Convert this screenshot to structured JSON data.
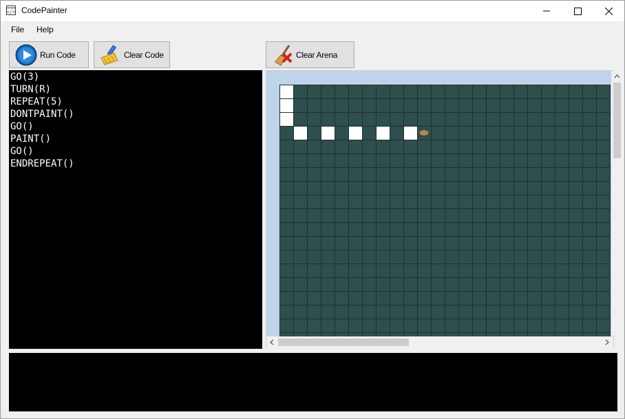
{
  "window": {
    "title": "CodePainter",
    "icon": "code-window-icon"
  },
  "menu": {
    "items": [
      "File",
      "Help"
    ]
  },
  "toolbar": {
    "run_label": "Run Code",
    "clear_code_label": "Clear Code",
    "clear_arena_label": "Clear Arena"
  },
  "editor": {
    "lines": [
      "GO(3)",
      "TURN(R)",
      "REPEAT(5)",
      "DONTPAINT()",
      "GO()",
      "PAINT()",
      "GO()",
      "ENDREPEAT()"
    ]
  },
  "arena": {
    "cell_color": "#2f4f4f",
    "grid_line_color": "#1f2f2f",
    "paint_color": "#ffffff",
    "background_color": "#bfd3ea",
    "columns": 24,
    "rows": 19,
    "painted_cells": [
      [
        0,
        0
      ],
      [
        0,
        1
      ],
      [
        0,
        2
      ],
      [
        1,
        3
      ],
      [
        3,
        3
      ],
      [
        5,
        3
      ],
      [
        7,
        3
      ],
      [
        9,
        3
      ]
    ],
    "robot_cell": [
      10,
      3
    ],
    "robot_icon": "painter-robot-icon"
  },
  "output": {
    "text": ""
  }
}
